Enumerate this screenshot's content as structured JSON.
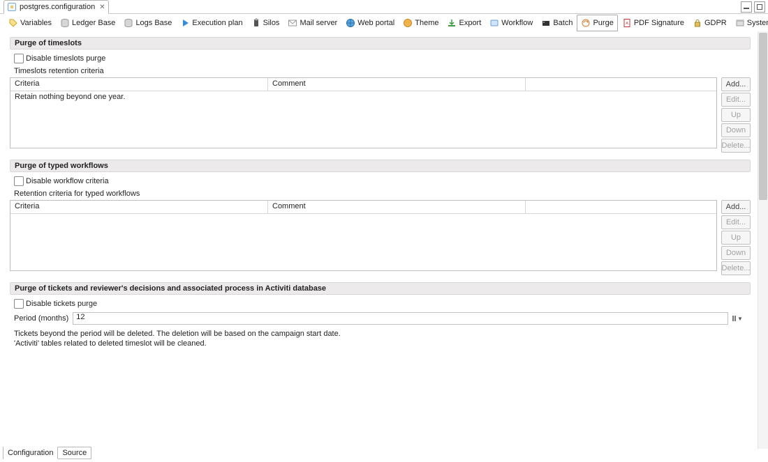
{
  "file_tab": {
    "title": "postgres.configuration",
    "icon": "config-file-icon"
  },
  "toolbar_tabs": [
    {
      "label": "Variables",
      "icon": "tag-icon"
    },
    {
      "label": "Ledger Base",
      "icon": "db-icon"
    },
    {
      "label": "Logs Base",
      "icon": "db-icon"
    },
    {
      "label": "Execution plan",
      "icon": "play-icon"
    },
    {
      "label": "Silos",
      "icon": "silo-icon"
    },
    {
      "label": "Mail server",
      "icon": "mail-icon"
    },
    {
      "label": "Web portal",
      "icon": "globe-icon"
    },
    {
      "label": "Theme",
      "icon": "theme-icon"
    },
    {
      "label": "Export",
      "icon": "export-icon"
    },
    {
      "label": "Workflow",
      "icon": "folder-icon"
    },
    {
      "label": "Batch",
      "icon": "batch-icon"
    },
    {
      "label": "Purge",
      "icon": "purge-icon",
      "active": true
    },
    {
      "label": "PDF Signature",
      "icon": "pdf-icon"
    },
    {
      "label": "GDPR",
      "icon": "lock-icon"
    },
    {
      "label": "System",
      "icon": "system-icon"
    }
  ],
  "sections": {
    "timeslots": {
      "header": "Purge of timeslots",
      "disable_label": "Disable timeslots purge",
      "criteria_label": "Timeslots retention criteria",
      "columns": {
        "criteria": "Criteria",
        "comment": "Comment"
      },
      "rows": [
        {
          "criteria": "Retain nothing  beyond one year.",
          "comment": ""
        }
      ]
    },
    "typed_workflows": {
      "header": "Purge of typed workflows",
      "disable_label": "Disable workflow criteria",
      "criteria_label": "Retention criteria for typed workflows",
      "columns": {
        "criteria": "Criteria",
        "comment": "Comment"
      },
      "rows": []
    },
    "tickets": {
      "header": "Purge of tickets and reviewer's decisions and associated process in Activiti database",
      "disable_label": "Disable tickets purge",
      "period_label": "Period (months)",
      "period_value": "12",
      "note_line1": "Tickets beyond the period will be deleted. The deletion will be based on the campaign start date.",
      "note_line2": "'Activiti' tables related to deleted timeslot will be cleaned."
    }
  },
  "buttons": {
    "add": "Add...",
    "edit": "Edit...",
    "up": "Up",
    "down": "Down",
    "delete": "Delete..."
  },
  "bottom_tabs": {
    "configuration": "Configuration",
    "source": "Source"
  }
}
